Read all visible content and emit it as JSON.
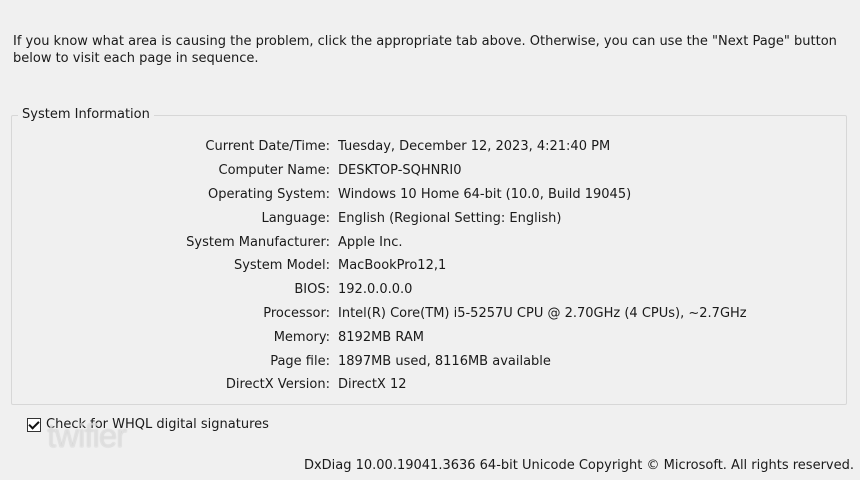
{
  "intro": {
    "text": "If you know what area is causing the problem, click the appropriate tab above.  Otherwise, you can use the \"Next Page\" button below to visit each page in sequence."
  },
  "system_information": {
    "title": "System Information",
    "rows": [
      {
        "label": "Current Date/Time:",
        "value": "Tuesday, December 12, 2023, 4:21:40 PM"
      },
      {
        "label": "Computer Name:",
        "value": "DESKTOP-SQHNRI0"
      },
      {
        "label": "Operating System:",
        "value": "Windows 10 Home 64-bit (10.0, Build 19045)"
      },
      {
        "label": "Language:",
        "value": "English (Regional Setting: English)"
      },
      {
        "label": "System Manufacturer:",
        "value": "Apple Inc."
      },
      {
        "label": "System Model:",
        "value": "MacBookPro12,1"
      },
      {
        "label": "BIOS:",
        "value": "192.0.0.0.0"
      },
      {
        "label": "Processor:",
        "value": "Intel(R) Core(TM) i5-5257U CPU @ 2.70GHz (4 CPUs), ~2.7GHz"
      },
      {
        "label": "Memory:",
        "value": "8192MB RAM"
      },
      {
        "label": "Page file:",
        "value": "1897MB used, 8116MB available"
      },
      {
        "label": "DirectX Version:",
        "value": "DirectX 12"
      }
    ]
  },
  "whql_checkbox": {
    "label": "Check for WHQL digital signatures",
    "checked": true
  },
  "watermark": "twifier",
  "footer": {
    "text": "DxDiag 10.00.19041.3636 64-bit Unicode  Copyright © Microsoft. All rights reserved."
  }
}
